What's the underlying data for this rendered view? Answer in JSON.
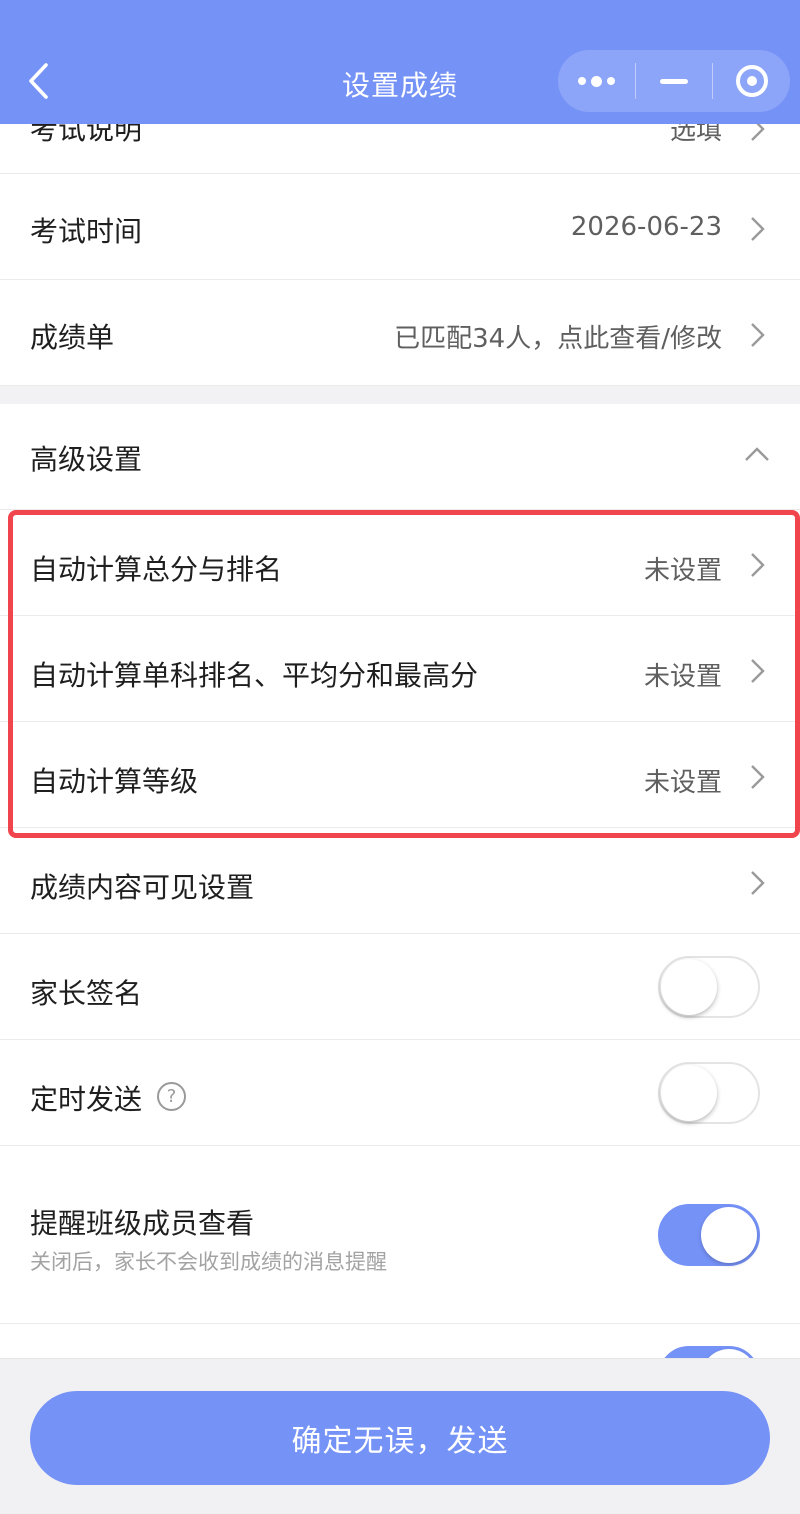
{
  "header": {
    "title": "设置成绩",
    "background_color": "#7592f7",
    "icons": [
      "back-icon",
      "more-icon",
      "minimize-icon",
      "close-target-icon"
    ]
  },
  "rows": {
    "exam_desc": {
      "label": "考试说明",
      "value": "选填"
    },
    "exam_time": {
      "label": "考试时间",
      "value": "2026-06-23"
    },
    "score_sheet": {
      "label": "成绩单",
      "value": "已匹配34人，点此查看/修改"
    },
    "advanced": {
      "label": "高级设置"
    },
    "auto_total": {
      "label": "自动计算总分与排名",
      "value": "未设置"
    },
    "auto_single": {
      "label": "自动计算单科排名、平均分和最高分",
      "value": "未设置"
    },
    "auto_grade": {
      "label": "自动计算等级",
      "value": "未设置"
    },
    "visibility": {
      "label": "成绩内容可见设置"
    },
    "parent_sign": {
      "label": "家长签名",
      "enabled": false
    },
    "scheduled_send": {
      "label": "定时发送",
      "help": "?",
      "enabled": false
    },
    "remind_members": {
      "label": "提醒班级成员查看",
      "subtext": "关闭后，家长不会收到成绩的消息提醒",
      "enabled": true
    },
    "partial_row": {
      "enabled": true
    }
  },
  "highlight_color": "#f0454c",
  "footer": {
    "confirm_label": "确定无误，发送"
  }
}
